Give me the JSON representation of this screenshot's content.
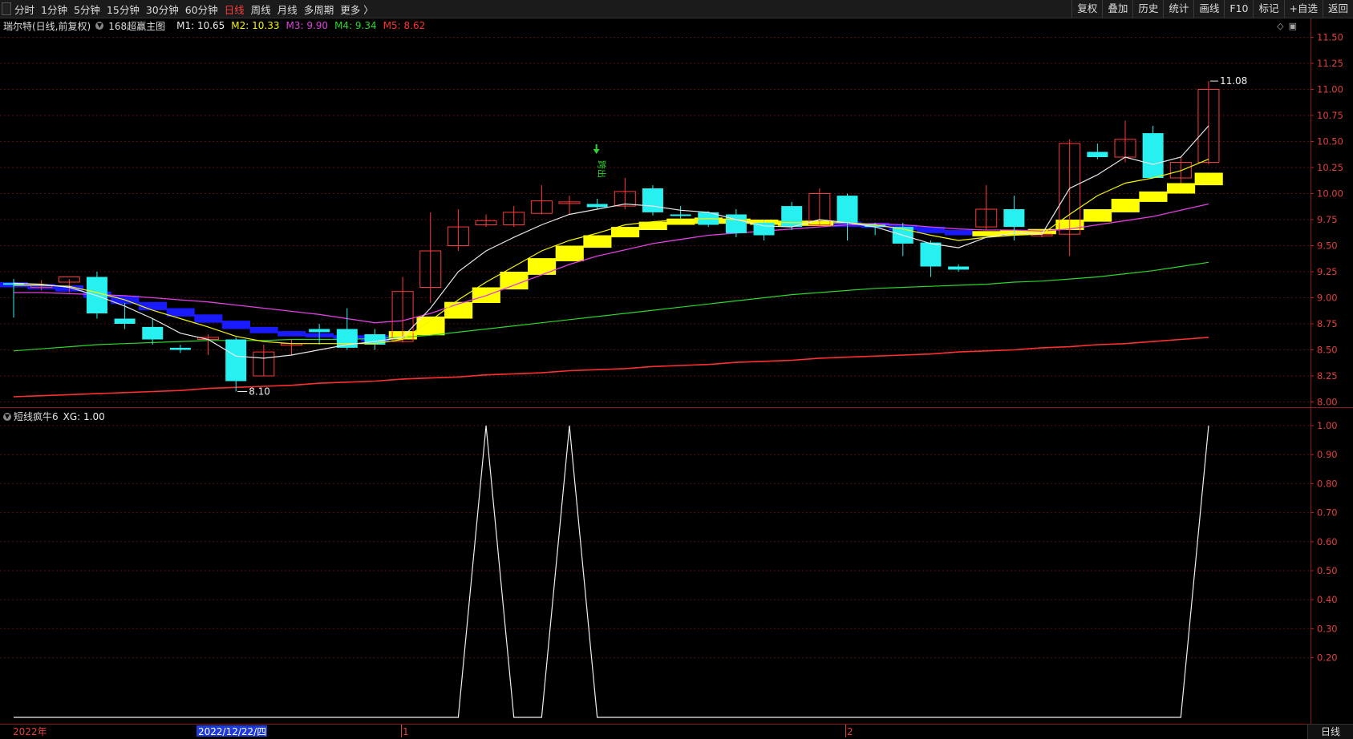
{
  "toolbar": {
    "left_items": [
      {
        "label": "分时",
        "active": false
      },
      {
        "label": "1分钟",
        "active": false
      },
      {
        "label": "5分钟",
        "active": false
      },
      {
        "label": "15分钟",
        "active": false
      },
      {
        "label": "30分钟",
        "active": false
      },
      {
        "label": "60分钟",
        "active": false
      },
      {
        "label": "日线",
        "active": true
      },
      {
        "label": "周线",
        "active": false
      },
      {
        "label": "月线",
        "active": false
      },
      {
        "label": "多周期",
        "active": false
      },
      {
        "label": "更多 〉",
        "active": false
      }
    ],
    "right_items": [
      "复权",
      "叠加",
      "历史",
      "统计",
      "画线",
      "F10",
      "标记",
      "+自选",
      "返回"
    ]
  },
  "main_info": {
    "stock": "瑞尔特(日线,前复权)",
    "indicator": "168超赢主图",
    "ma": [
      {
        "label": "M1: 10.65",
        "color": "#e8e8e8"
      },
      {
        "label": "M2: 10.33",
        "color": "#f5f500"
      },
      {
        "label": "M3: 9.90",
        "color": "#e040e0"
      },
      {
        "label": "M4: 9.34",
        "color": "#2cd62c"
      },
      {
        "label": "M5: 8.62",
        "color": "#ff3030"
      }
    ]
  },
  "sub_info": {
    "indicator": "短线疯牛6",
    "value": "XG: 1.00"
  },
  "price_axis": [
    "11.50",
    "11.25",
    "11.00",
    "10.75",
    "10.50",
    "10.25",
    "10.00",
    "9.75",
    "9.50",
    "9.25",
    "9.00",
    "8.75",
    "8.50",
    "8.25",
    "8.00"
  ],
  "sub_axis": [
    "1.00",
    "0.90",
    "0.80",
    "0.70",
    "0.60",
    "0.50",
    "0.40",
    "0.30",
    "0.20"
  ],
  "annotations": {
    "high": "11.08",
    "low": "8.10",
    "signal": "跨出"
  },
  "date_labels": {
    "year": "2022年",
    "selected": "2022/12/22/四",
    "m1": "1",
    "m2": "2"
  },
  "status_label": "日线",
  "colors": {
    "up": "#ff3b3b",
    "down": "#26f0f0",
    "ma1": "#e8e8e8",
    "ma2": "#f5f500",
    "ma3": "#e040e0",
    "ma4": "#2cd62c",
    "ma5": "#ff3030",
    "band_up": "#ffff00",
    "band_down": "#1a1aff"
  },
  "chart_data": {
    "type": "candlestick",
    "price_range": [
      7.95,
      11.55
    ],
    "candles": [
      {
        "o": 9.14,
        "h": 9.18,
        "l": 8.81,
        "c": 9.13
      },
      {
        "o": 9.1,
        "h": 9.17,
        "l": 9.07,
        "c": 9.12
      },
      {
        "o": 9.15,
        "h": 9.18,
        "l": 9.05,
        "c": 9.2
      },
      {
        "o": 9.2,
        "h": 9.25,
        "l": 8.8,
        "c": 8.85
      },
      {
        "o": 8.8,
        "h": 8.95,
        "l": 8.7,
        "c": 8.75
      },
      {
        "o": 8.72,
        "h": 8.8,
        "l": 8.55,
        "c": 8.6
      },
      {
        "o": 8.52,
        "h": 8.55,
        "l": 8.47,
        "c": 8.5
      },
      {
        "o": 8.6,
        "h": 8.65,
        "l": 8.45,
        "c": 8.62
      },
      {
        "o": 8.6,
        "h": 8.62,
        "l": 8.1,
        "c": 8.2
      },
      {
        "o": 8.25,
        "h": 8.55,
        "l": 8.25,
        "c": 8.48
      },
      {
        "o": 8.55,
        "h": 8.6,
        "l": 8.45,
        "c": 8.56
      },
      {
        "o": 8.7,
        "h": 8.75,
        "l": 8.55,
        "c": 8.67
      },
      {
        "o": 8.7,
        "h": 8.9,
        "l": 8.5,
        "c": 8.52
      },
      {
        "o": 8.65,
        "h": 8.7,
        "l": 8.5,
        "c": 8.55
      },
      {
        "o": 8.58,
        "h": 9.2,
        "l": 8.57,
        "c": 9.06
      },
      {
        "o": 9.1,
        "h": 9.82,
        "l": 8.95,
        "c": 9.45
      },
      {
        "o": 9.5,
        "h": 9.85,
        "l": 9.45,
        "c": 9.68
      },
      {
        "o": 9.7,
        "h": 9.8,
        "l": 9.68,
        "c": 9.74
      },
      {
        "o": 9.7,
        "h": 9.88,
        "l": 9.68,
        "c": 9.82
      },
      {
        "o": 9.81,
        "h": 10.08,
        "l": 9.8,
        "c": 9.93
      },
      {
        "o": 9.92,
        "h": 9.98,
        "l": 9.8,
        "c": 9.92
      },
      {
        "o": 9.9,
        "h": 9.95,
        "l": 9.85,
        "c": 9.87
      },
      {
        "o": 9.88,
        "h": 10.15,
        "l": 9.85,
        "c": 10.02
      },
      {
        "o": 10.05,
        "h": 10.08,
        "l": 9.79,
        "c": 9.82
      },
      {
        "o": 9.8,
        "h": 9.88,
        "l": 9.75,
        "c": 9.79
      },
      {
        "o": 9.82,
        "h": 9.83,
        "l": 9.68,
        "c": 9.7
      },
      {
        "o": 9.8,
        "h": 9.85,
        "l": 9.58,
        "c": 9.62
      },
      {
        "o": 9.72,
        "h": 9.75,
        "l": 9.55,
        "c": 9.6
      },
      {
        "o": 9.88,
        "h": 9.92,
        "l": 9.65,
        "c": 9.68
      },
      {
        "o": 9.7,
        "h": 10.05,
        "l": 9.68,
        "c": 10.0
      },
      {
        "o": 9.98,
        "h": 10.0,
        "l": 9.55,
        "c": 9.72
      },
      {
        "o": 9.7,
        "h": 9.72,
        "l": 9.6,
        "c": 9.68
      },
      {
        "o": 9.68,
        "h": 9.72,
        "l": 9.4,
        "c": 9.52
      },
      {
        "o": 9.53,
        "h": 9.55,
        "l": 9.2,
        "c": 9.3
      },
      {
        "o": 9.3,
        "h": 9.32,
        "l": 9.25,
        "c": 9.27
      },
      {
        "o": 9.68,
        "h": 10.08,
        "l": 9.65,
        "c": 9.85
      },
      {
        "o": 9.85,
        "h": 9.98,
        "l": 9.55,
        "c": 9.68
      },
      {
        "o": 9.6,
        "h": 9.62,
        "l": 9.58,
        "c": 9.61
      },
      {
        "o": 9.61,
        "h": 10.52,
        "l": 9.4,
        "c": 10.48
      },
      {
        "o": 10.4,
        "h": 10.48,
        "l": 10.33,
        "c": 10.35
      },
      {
        "o": 10.35,
        "h": 10.7,
        "l": 10.3,
        "c": 10.52
      },
      {
        "o": 10.58,
        "h": 10.65,
        "l": 10.15,
        "c": 10.15
      },
      {
        "o": 10.15,
        "h": 10.35,
        "l": 10.1,
        "c": 10.3
      },
      {
        "o": 10.3,
        "h": 11.08,
        "l": 10.28,
        "c": 11.0
      }
    ],
    "ma1": [
      9.14,
      9.13,
      9.1,
      9.02,
      8.92,
      8.8,
      8.66,
      8.6,
      8.44,
      8.42,
      8.45,
      8.5,
      8.55,
      8.58,
      8.62,
      8.9,
      9.25,
      9.45,
      9.58,
      9.7,
      9.8,
      9.85,
      9.9,
      9.88,
      9.84,
      9.82,
      9.75,
      9.69,
      9.68,
      9.75,
      9.72,
      9.68,
      9.6,
      9.52,
      9.48,
      9.58,
      9.62,
      9.61,
      10.05,
      10.18,
      10.35,
      10.28,
      10.35,
      10.65
    ],
    "ma2": [
      9.12,
      9.12,
      9.11,
      9.05,
      8.98,
      8.88,
      8.8,
      8.72,
      8.63,
      8.58,
      8.56,
      8.56,
      8.56,
      8.56,
      8.6,
      8.78,
      8.98,
      9.15,
      9.3,
      9.45,
      9.55,
      9.62,
      9.7,
      9.73,
      9.75,
      9.76,
      9.75,
      9.73,
      9.72,
      9.72,
      9.72,
      9.7,
      9.66,
      9.6,
      9.55,
      9.58,
      9.6,
      9.61,
      9.8,
      9.98,
      10.1,
      10.15,
      10.22,
      10.33
    ],
    "ma3": [
      9.05,
      9.05,
      9.04,
      9.03,
      9.02,
      9.0,
      8.98,
      8.96,
      8.93,
      8.9,
      8.87,
      8.84,
      8.8,
      8.76,
      8.78,
      8.85,
      8.94,
      9.02,
      9.12,
      9.22,
      9.32,
      9.4,
      9.46,
      9.52,
      9.56,
      9.6,
      9.62,
      9.64,
      9.66,
      9.68,
      9.7,
      9.71,
      9.7,
      9.68,
      9.66,
      9.65,
      9.65,
      9.64,
      9.66,
      9.7,
      9.74,
      9.78,
      9.84,
      9.9
    ],
    "ma4": [
      8.49,
      8.51,
      8.53,
      8.55,
      8.56,
      8.57,
      8.58,
      8.59,
      8.59,
      8.59,
      8.6,
      8.6,
      8.6,
      8.61,
      8.62,
      8.64,
      8.67,
      8.7,
      8.73,
      8.76,
      8.79,
      8.82,
      8.85,
      8.88,
      8.91,
      8.94,
      8.97,
      9.0,
      9.03,
      9.05,
      9.07,
      9.09,
      9.1,
      9.11,
      9.12,
      9.13,
      9.15,
      9.16,
      9.18,
      9.2,
      9.23,
      9.26,
      9.3,
      9.34
    ],
    "ma5": [
      8.05,
      8.06,
      8.07,
      8.08,
      8.09,
      8.1,
      8.11,
      8.13,
      8.14,
      8.15,
      8.16,
      8.18,
      8.19,
      8.2,
      8.22,
      8.23,
      8.24,
      8.26,
      8.27,
      8.28,
      8.3,
      8.31,
      8.32,
      8.34,
      8.35,
      8.36,
      8.38,
      8.39,
      8.4,
      8.42,
      8.43,
      8.44,
      8.45,
      8.46,
      8.48,
      8.49,
      8.5,
      8.52,
      8.53,
      8.55,
      8.56,
      8.58,
      8.6,
      8.62
    ],
    "band": [
      {
        "a": 9.15,
        "b": 9.1,
        "up": false
      },
      {
        "a": 9.13,
        "b": 9.08,
        "up": false
      },
      {
        "a": 9.12,
        "b": 9.06,
        "up": false
      },
      {
        "a": 9.06,
        "b": 9.0,
        "up": false
      },
      {
        "a": 9.02,
        "b": 8.94,
        "up": false
      },
      {
        "a": 8.96,
        "b": 8.88,
        "up": false
      },
      {
        "a": 8.9,
        "b": 8.82,
        "up": false
      },
      {
        "a": 8.84,
        "b": 8.76,
        "up": false
      },
      {
        "a": 8.78,
        "b": 8.7,
        "up": false
      },
      {
        "a": 8.72,
        "b": 8.66,
        "up": false
      },
      {
        "a": 8.68,
        "b": 8.63,
        "up": false
      },
      {
        "a": 8.66,
        "b": 8.62,
        "up": false
      },
      {
        "a": 8.64,
        "b": 8.6,
        "up": false
      },
      {
        "a": 8.64,
        "b": 8.58,
        "up": false
      },
      {
        "a": 8.68,
        "b": 8.6,
        "up": true
      },
      {
        "a": 8.82,
        "b": 8.64,
        "up": true
      },
      {
        "a": 8.96,
        "b": 8.8,
        "up": true
      },
      {
        "a": 9.1,
        "b": 8.95,
        "up": true
      },
      {
        "a": 9.25,
        "b": 9.08,
        "up": true
      },
      {
        "a": 9.38,
        "b": 9.22,
        "up": true
      },
      {
        "a": 9.5,
        "b": 9.35,
        "up": true
      },
      {
        "a": 9.6,
        "b": 9.48,
        "up": true
      },
      {
        "a": 9.68,
        "b": 9.58,
        "up": true
      },
      {
        "a": 9.73,
        "b": 9.65,
        "up": true
      },
      {
        "a": 9.76,
        "b": 9.7,
        "up": true
      },
      {
        "a": 9.77,
        "b": 9.71,
        "up": true
      },
      {
        "a": 9.76,
        "b": 9.71,
        "up": true
      },
      {
        "a": 9.75,
        "b": 9.7,
        "up": true
      },
      {
        "a": 9.74,
        "b": 9.69,
        "up": true
      },
      {
        "a": 9.74,
        "b": 9.69,
        "up": true
      },
      {
        "a": 9.73,
        "b": 9.68,
        "up": false
      },
      {
        "a": 9.72,
        "b": 9.67,
        "up": false
      },
      {
        "a": 9.7,
        "b": 9.65,
        "up": false
      },
      {
        "a": 9.68,
        "b": 9.62,
        "up": false
      },
      {
        "a": 9.65,
        "b": 9.6,
        "up": false
      },
      {
        "a": 9.64,
        "b": 9.59,
        "up": true
      },
      {
        "a": 9.65,
        "b": 9.6,
        "up": true
      },
      {
        "a": 9.66,
        "b": 9.61,
        "up": true
      },
      {
        "a": 9.75,
        "b": 9.65,
        "up": true
      },
      {
        "a": 9.85,
        "b": 9.73,
        "up": true
      },
      {
        "a": 9.95,
        "b": 9.82,
        "up": true
      },
      {
        "a": 10.02,
        "b": 9.92,
        "up": true
      },
      {
        "a": 10.1,
        "b": 10.0,
        "up": true
      },
      {
        "a": 10.2,
        "b": 10.08,
        "up": true
      }
    ],
    "xg": [
      0,
      0,
      0,
      0,
      0,
      0,
      0,
      0,
      0,
      0,
      0,
      0,
      0,
      0,
      0,
      0,
      0,
      1,
      0,
      0,
      1,
      0,
      0,
      0,
      0,
      0,
      0,
      0,
      0,
      0,
      0,
      0,
      0,
      0,
      0,
      0,
      0,
      0,
      0,
      0,
      0,
      0,
      0,
      1
    ]
  }
}
